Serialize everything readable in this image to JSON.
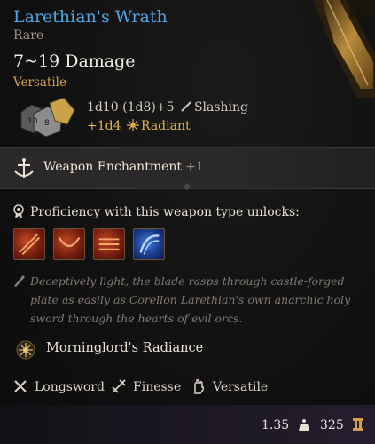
{
  "item": {
    "name": "Larethian's Wrath",
    "rarity": "Rare",
    "damage": "7~19 Damage",
    "property_tag": "Versatile",
    "damage_roll": "1d10 (1d8)+5",
    "damage_type": "Slashing",
    "bonus_roll": "+1d4",
    "bonus_type": "Radiant",
    "colors": {
      "title": "#4aa6e6",
      "gold": "#d4a14a",
      "bonus": "#e3b24b"
    }
  },
  "dice_icon": {
    "label_left": "10",
    "label_right": "8",
    "icon": "dice-icon"
  },
  "enchantment": {
    "label": "Weapon Enchantment",
    "bonus": "+1",
    "icon": "enchantment-icon"
  },
  "proficiency": {
    "label": "Proficiency with this weapon type unlocks:",
    "actions": [
      {
        "name": "action-1",
        "icon": "slash-action-icon"
      },
      {
        "name": "action-2",
        "icon": "cleave-action-icon"
      },
      {
        "name": "action-3",
        "icon": "lacerate-action-icon"
      },
      {
        "name": "action-4",
        "icon": "arcane-action-icon"
      }
    ]
  },
  "description": "Deceptively light, the blade rasps through castle-forged plate as easily as Corellon Larethian's own anarchic holy sword through the hearts of evil orcs.",
  "passive": {
    "label": "Morninglord's Radiance",
    "icon": "sun-icon"
  },
  "properties": [
    {
      "label": "Longsword",
      "icon": "longsword-icon"
    },
    {
      "label": "Finesse",
      "icon": "finesse-icon"
    },
    {
      "label": "Versatile",
      "icon": "hand-icon"
    }
  ],
  "footer": {
    "weight": "1.35",
    "value": "325"
  }
}
